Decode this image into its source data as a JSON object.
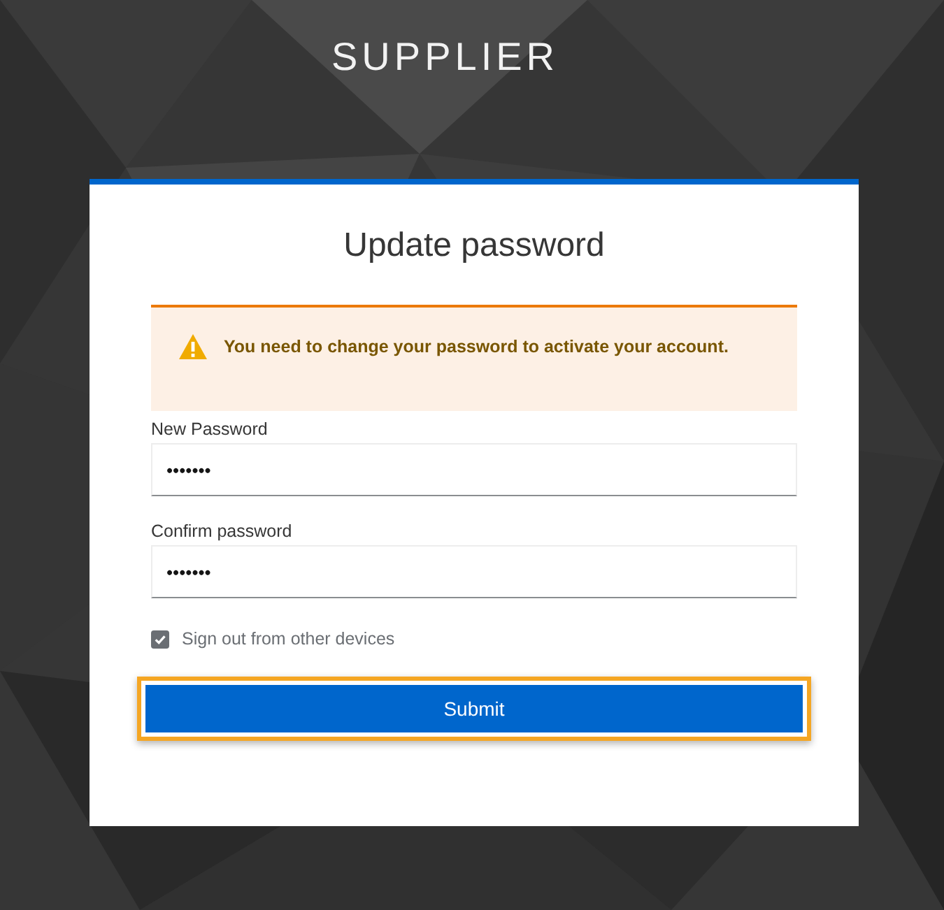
{
  "header": {
    "title": "SUPPLIER"
  },
  "card": {
    "title": "Update password"
  },
  "alert": {
    "kind": "warning",
    "message": "You need to change your password to activate your account."
  },
  "fields": [
    {
      "label": "New Password",
      "value": "•••••••"
    },
    {
      "label": "Confirm password",
      "value": "•••••••"
    }
  ],
  "checkbox": {
    "label": "Sign out from other devices",
    "checked": true
  },
  "submit": {
    "label": "Submit",
    "highlighted": true
  }
}
